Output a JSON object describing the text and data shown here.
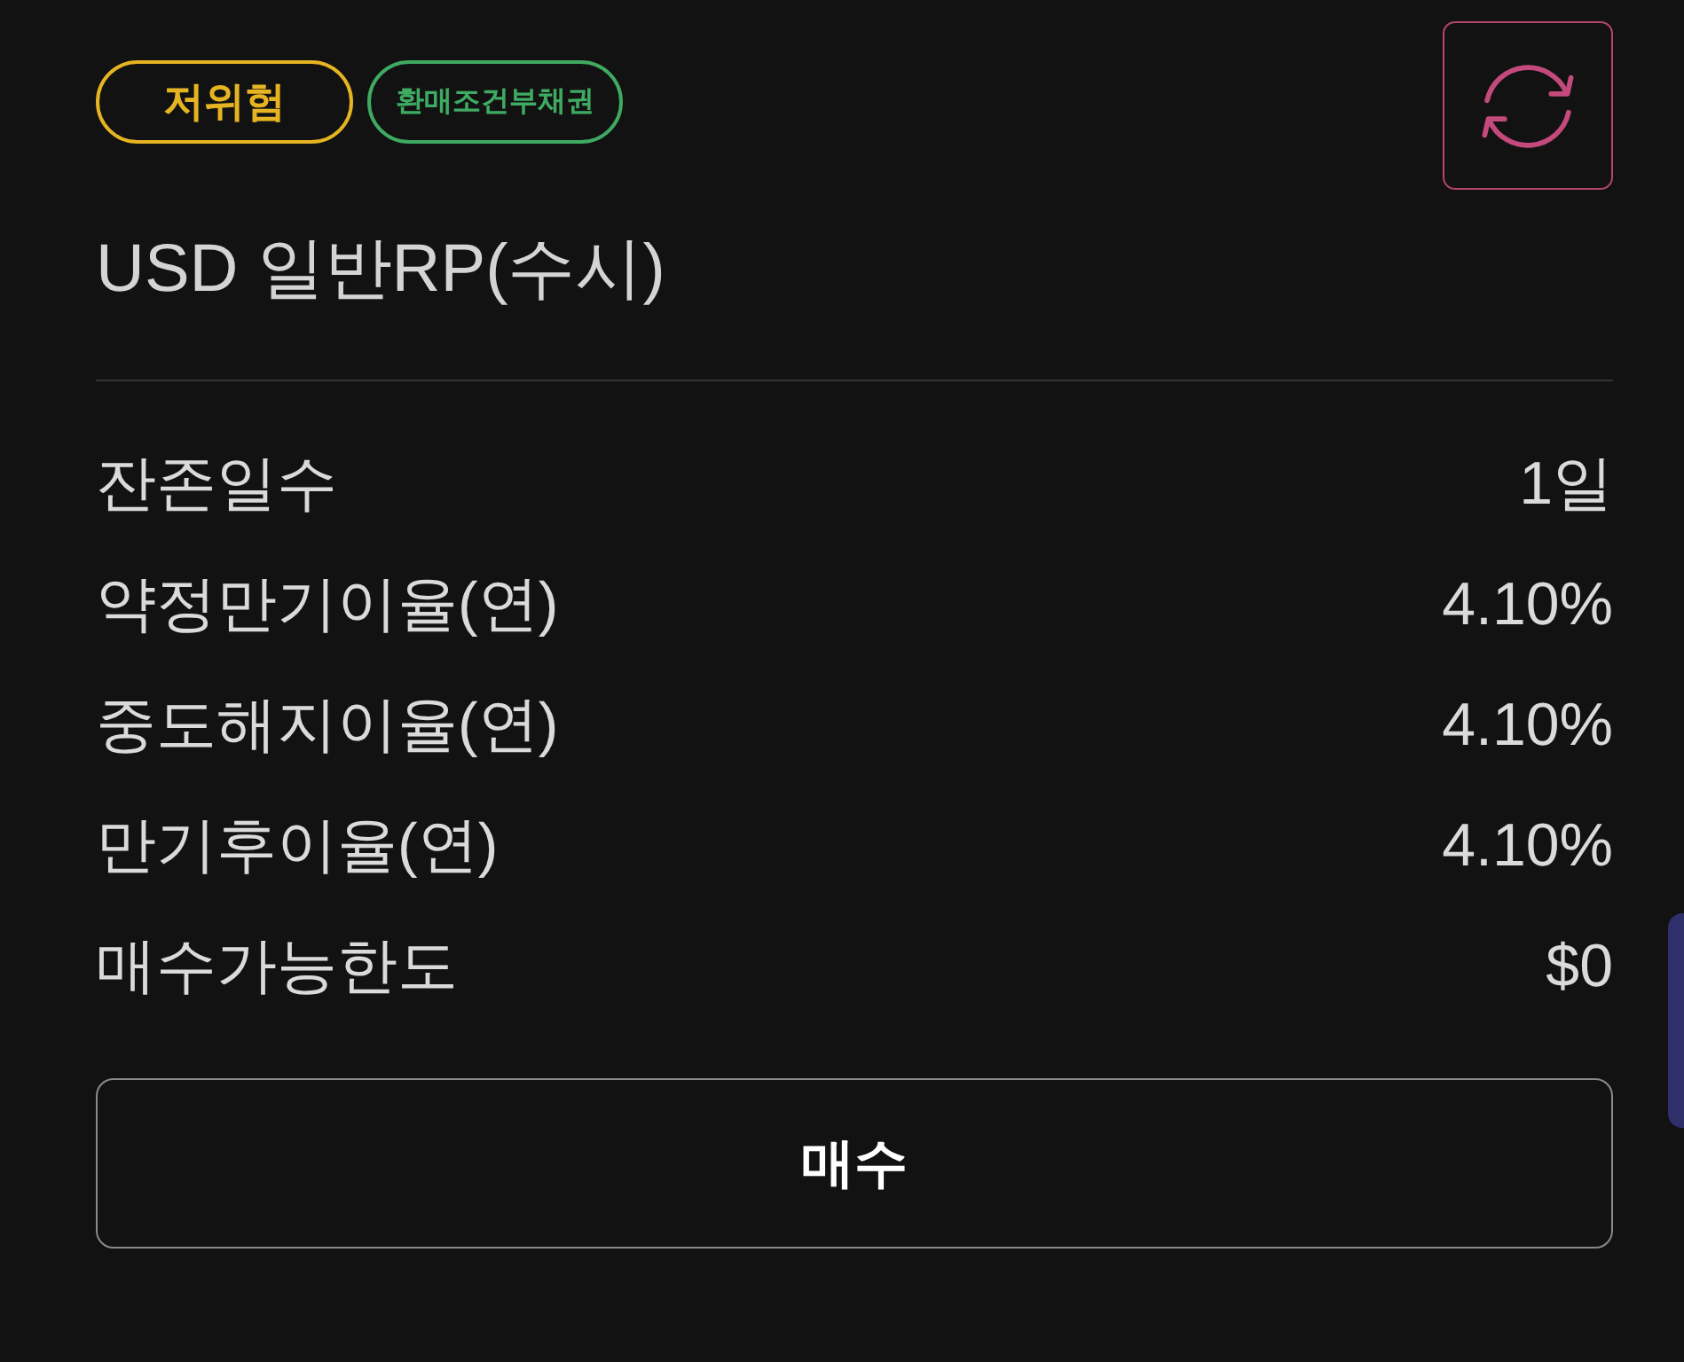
{
  "badges": [
    {
      "kind": "risk",
      "label": "저위험",
      "color": "#e6b422"
    },
    {
      "kind": "category",
      "label": "환매조건부채권",
      "color": "#3faa62"
    }
  ],
  "title": "USD 일반RP(수시)",
  "details": [
    {
      "label": "잔존일수",
      "value": "1일"
    },
    {
      "label": "약정만기이율(연)",
      "value": "4.10%"
    },
    {
      "label": "중도해지이율(연)",
      "value": "4.10%"
    },
    {
      "label": "만기후이율(연)",
      "value": "4.10%"
    },
    {
      "label": "매수가능한도",
      "value": "$0"
    }
  ],
  "buy_button": {
    "label": "매수"
  }
}
